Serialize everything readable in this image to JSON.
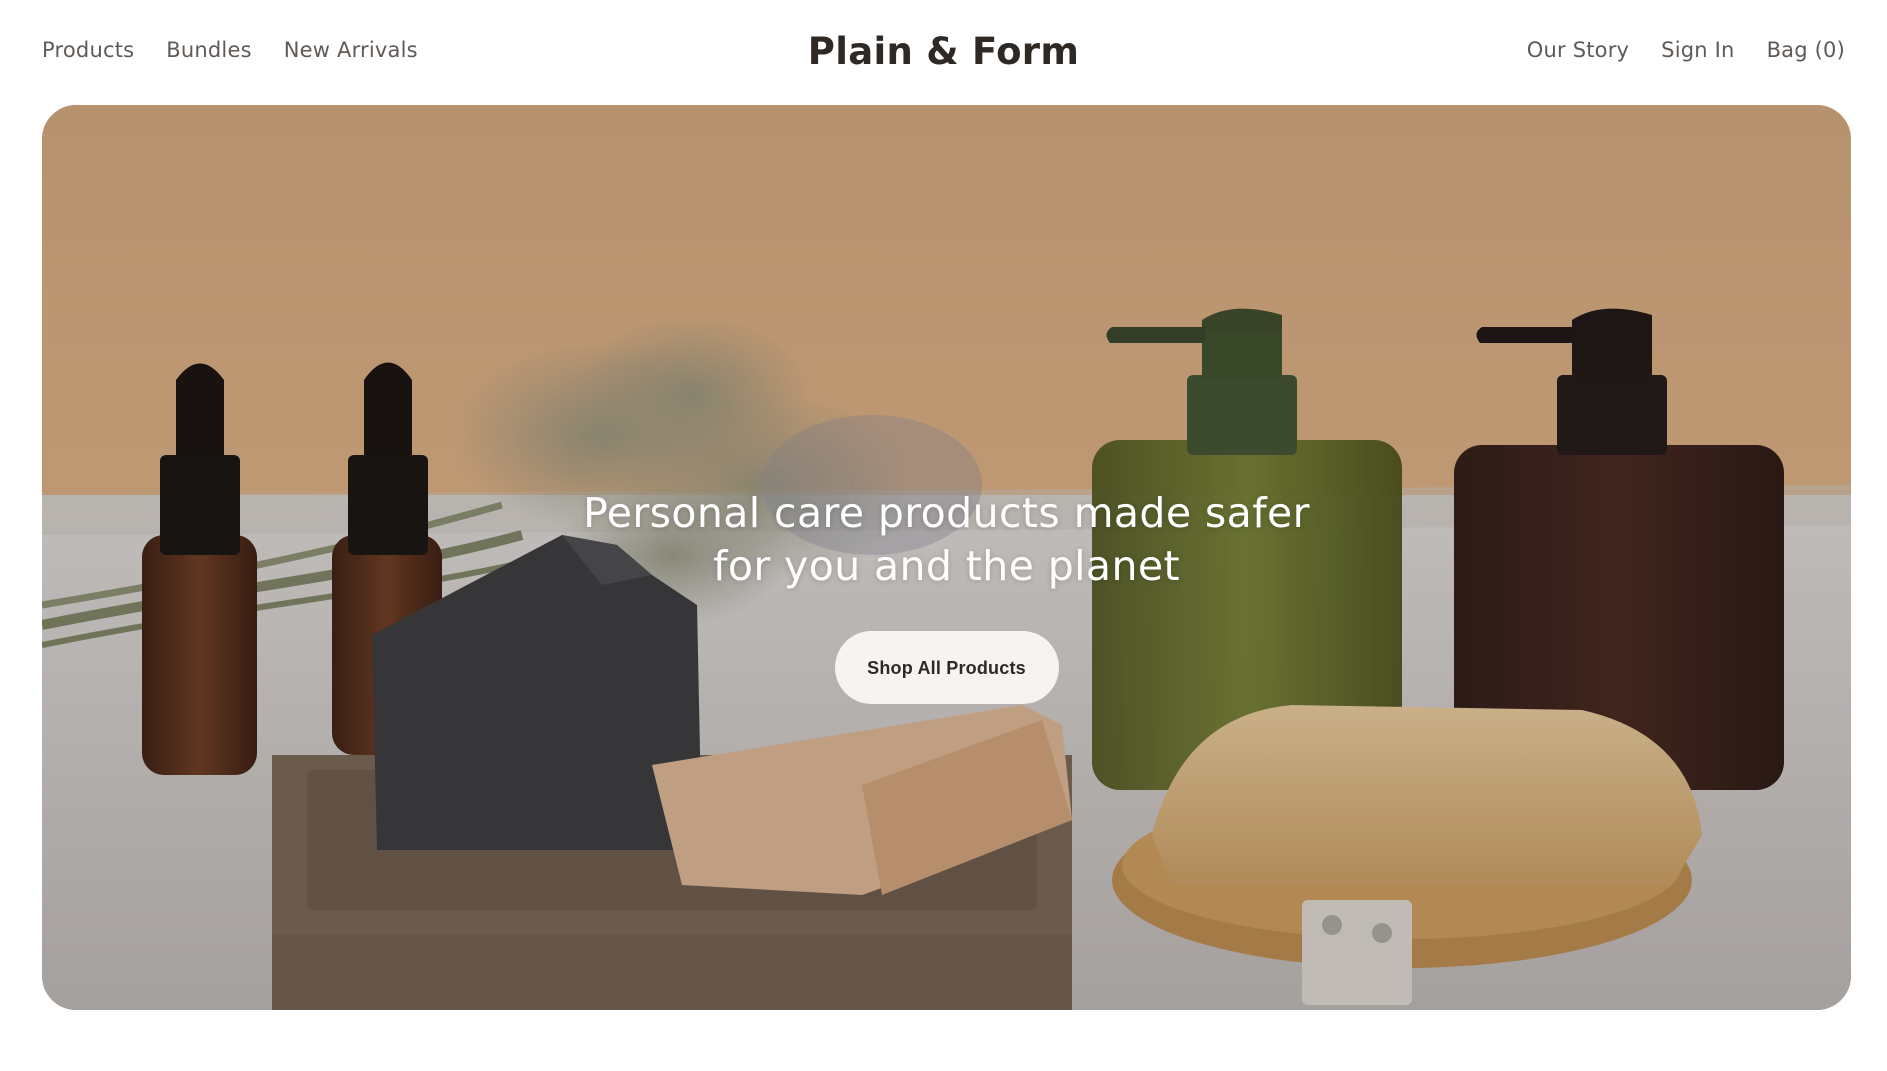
{
  "brand": {
    "name": "Plain & Form"
  },
  "nav_left": [
    {
      "label": "Products"
    },
    {
      "label": "Bundles"
    },
    {
      "label": "New Arrivals"
    }
  ],
  "nav_right": [
    {
      "label": "Our Story"
    },
    {
      "label": "Sign In"
    },
    {
      "label": "Bag (0)"
    }
  ],
  "hero": {
    "headline_line1": "Personal care products made safer",
    "headline_line2": "for you and the planet",
    "cta_label": "Shop All Products",
    "image_subject": "soap-bars-dropper-bottles-pump-bottles-brush-lavender"
  },
  "colors": {
    "text_dark": "#2f2925",
    "nav_text": "#5f5a56",
    "hero_wall": "#d4ab82",
    "cta_bg": "#f5f4f3"
  }
}
